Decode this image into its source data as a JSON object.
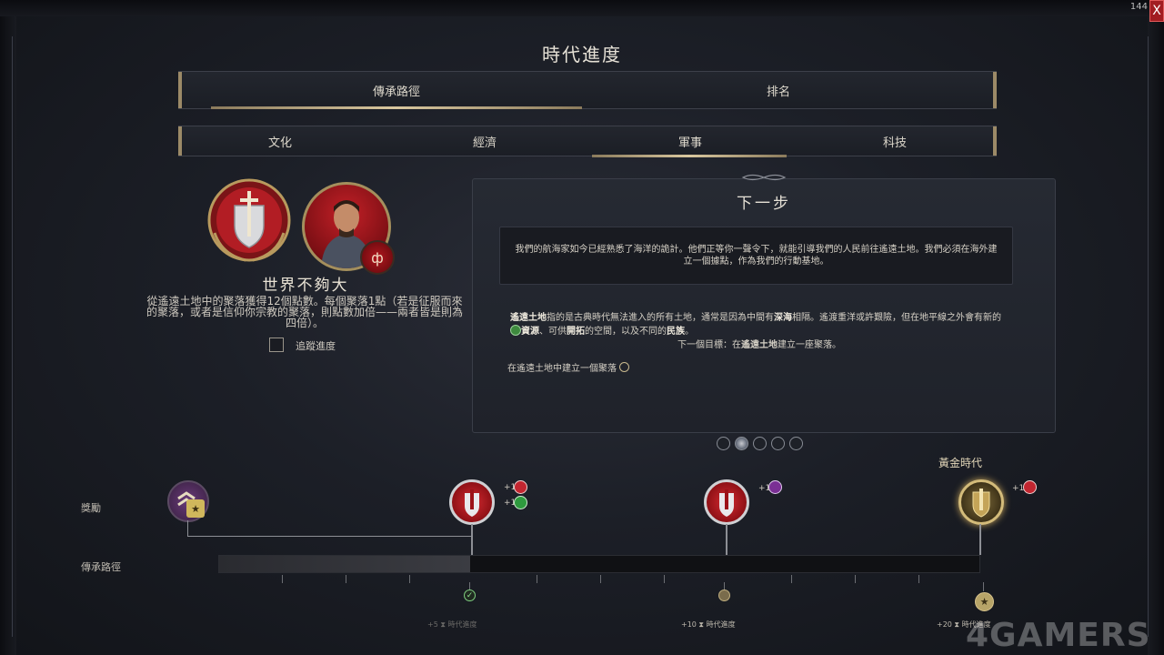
{
  "corner_label": "144",
  "window": {
    "title": "時代進度",
    "close_label": "X"
  },
  "main_tabs": [
    {
      "label": "傳承路徑",
      "selected": true
    },
    {
      "label": "排名",
      "selected": false
    }
  ],
  "sub_tabs": [
    {
      "label": "文化",
      "selected": false
    },
    {
      "label": "經濟",
      "selected": false
    },
    {
      "label": "軍事",
      "selected": true
    },
    {
      "label": "科技",
      "selected": false
    }
  ],
  "achievement": {
    "title": "世界不夠大",
    "description": "從遙遠土地中的聚落獲得12個點數。每個聚落1點（若是征服而來的聚落，或者是信仰你宗教的聚落，則點數加倍——兩者皆是則為四倍）。",
    "track_label": "追蹤進度",
    "track_checked": false
  },
  "next_step": {
    "title": "下一步",
    "quote": "我們的航海家如今已經熟悉了海洋的詭計。他們正等你一聲令下，就能引導我們的人民前往遙遠土地。我們必須在海外建立一個據點，作為我們的行動基地。",
    "body": {
      "term": "遙遠土地",
      "part1": "指的是古典時代無法進入的所有土地，通常是因為中間有",
      "deep_sea": "深海",
      "part2": "相隔。遙渡重洋或許艱險，但在地平線之外會有新的",
      "resources": "資源",
      "part3": "、可供",
      "expansion": "開拓",
      "part4": "的空間，以及不同的",
      "peoples": "民族",
      "part5": "。"
    },
    "next_goal_prefix": "下一個目標：在",
    "next_goal_term": "遙遠土地",
    "next_goal_suffix": "建立一座聚落。",
    "objective": "在遙遠土地中建立一個聚落"
  },
  "pager": {
    "count": 5,
    "active_index": 1
  },
  "rows": {
    "rewards": "獎勵",
    "legacy_path": "傳承路徑"
  },
  "golden_age_label": "黃金時代",
  "milestones": [
    {
      "bonuses": [
        {
          "text": "+1",
          "color": "#c22630"
        },
        {
          "text": "+1",
          "color": "#2e9a3e"
        }
      ],
      "gold": false
    },
    {
      "bonuses": [
        {
          "text": "+1",
          "color": "#7a2f94"
        }
      ],
      "gold": false
    },
    {
      "bonuses": [
        {
          "text": "+1",
          "color": "#c22630"
        }
      ],
      "gold": true
    }
  ],
  "progress": {
    "fraction": 0.33
  },
  "era_points": [
    {
      "value": "+5",
      "label": "時代進度",
      "state": "completed"
    },
    {
      "value": "+10",
      "label": "時代進度",
      "state": "pending"
    },
    {
      "value": "+20",
      "label": "時代進度",
      "state": "final"
    }
  ],
  "colors": {
    "accent_gold": "#c9b98e",
    "military_red": "#c22630",
    "background": "#1c1f27"
  },
  "watermark": "4GAMERS"
}
